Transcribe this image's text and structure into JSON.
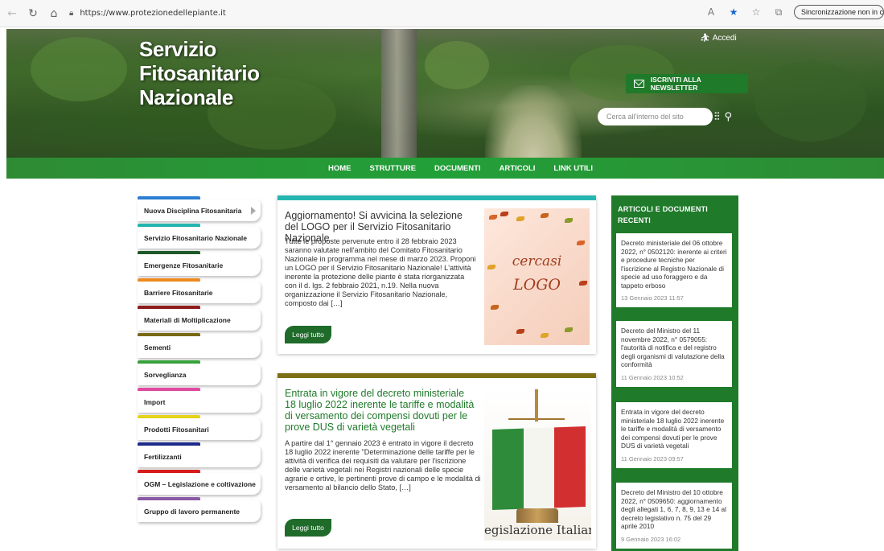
{
  "browser": {
    "url": "https://www.protezionedellepiante.it",
    "sync_label": "Sincronizzazione non in corso"
  },
  "header": {
    "title_lines": [
      "Servizio",
      "Fitosanitario",
      "Nazionale"
    ],
    "login": "Accedi",
    "newsletter": "ISCRIVITI ALLA NEWSLETTER",
    "search_placeholder": "Cerca all'interno del sito"
  },
  "nav": {
    "items": [
      "HOME",
      "STRUTTURE",
      "DOCUMENTI",
      "ARTICOLI",
      "LINK UTILI"
    ]
  },
  "sidebar": {
    "items": [
      {
        "label": "Nuova Disciplina Fitosanitaria",
        "color": "#2d7fd3"
      },
      {
        "label": "Servizio Fitosanitario Nazionale",
        "color": "#23b5b0"
      },
      {
        "label": "Emergenze Fitosanitarie",
        "color": "#1f5a2a"
      },
      {
        "label": "Barriere Fitosanitarie",
        "color": "#ef8a1e"
      },
      {
        "label": "Materiali di Moltiplicazione",
        "color": "#8c1c1c"
      },
      {
        "label": "Sementi",
        "color": "#7a6a14"
      },
      {
        "label": "Sorveglianza",
        "color": "#37a23c"
      },
      {
        "label": "Import",
        "color": "#e04aa0"
      },
      {
        "label": "Prodotti Fitosanitari",
        "color": "#e6d41c"
      },
      {
        "label": "Fertilizzanti",
        "color": "#1c2a8a"
      },
      {
        "label": "OGM – Legislazione e coltivazione",
        "color": "#d81c1c"
      },
      {
        "label": "Gruppo di lavoro permanente",
        "color": "#8a5aa8"
      }
    ]
  },
  "articles": [
    {
      "title": "Aggiornamento! Si avvicina la selezione del LOGO per il Servizio Fitosanitario Nazionale.",
      "body": "Tutte le proposte pervenute entro il 28 febbraio 2023 saranno valutate nell'ambito del Comitato Fitosanitario Nazionale in programma nel mese di marzo 2023. Proponi un LOGO per il Servizio Fitosanitario Nazionale! L'attività inerente la protezione delle piante è stata riorganizzata con il d. lgs. 2 febbraio 2021, n.19.  Nella nuova organizzazione il Servizio Fitosanitario Nazionale,  composto dai […]",
      "button": "Leggi tutto",
      "image_text": [
        "cercasi",
        "LOGO"
      ],
      "bar_color": "#26b6b0"
    },
    {
      "title": "Entrata in vigore del decreto ministeriale 18 luglio 2022 inerente le tariffe e modalità di versamento dei compensi dovuti per le prove DUS di varietà vegetali",
      "body": "A partire dal 1° gennaio 2023 è entrato in vigore il decreto 18 luglio 2022 inerente \"Determinazione delle tariffe per le attività di verifica dei requisiti da valutare per l'iscrizione delle varietà vegetali nei Registri nazionali delle specie agrarie e ortive, le pertinenti prove di campo e le modalità di versamento al bilancio dello Stato, […]",
      "button": "Leggi tutto",
      "image_text": "egislazione Italian",
      "bar_color": "#7d7014"
    }
  ],
  "recent": {
    "heading": "ARTICOLI E DOCUMENTI RECENTI",
    "items": [
      {
        "title": "Decreto ministeriale del 06 ottobre 2022, n° 0502120: inerente ai criteri e procedure tecniche per l'iscrizione al Registro Nazionale di specie ad uso foraggero e da tappeto erboso",
        "date": "13 Gennaio 2023 11:57"
      },
      {
        "title": "Decreto del Ministro del 11 novembre 2022, n° 0579055: l'autorità di notifica e del registro degli organismi di valutazione della conformità",
        "date": "11 Gennaio 2023 10:52"
      },
      {
        "title": "Entrata in vigore del decreto ministeriale 18 luglio 2022 inerente le tariffe e modalità di versamento dei compensi dovuti per le prove DUS di varietà vegetali",
        "date": "11 Gennaio 2023 09:57"
      },
      {
        "title": "Decreto del Ministro del 10 ottobre 2022, n° 0509650: aggiornamento degli allegati 1, 6, 7, 8, 9, 13 e 14 al decreto legislativo n. 75 del 29 aprile 2010",
        "date": "9 Gennaio 2023 16:02"
      }
    ]
  }
}
